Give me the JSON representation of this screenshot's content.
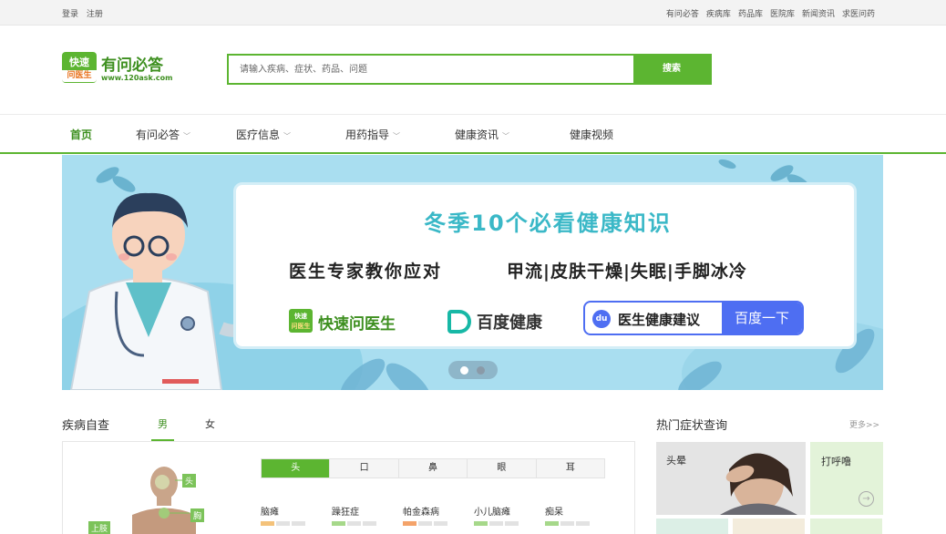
{
  "topbar": {
    "login": "登录",
    "register": "注册",
    "links": [
      "有问必答",
      "疾病库",
      "药品库",
      "医院库",
      "新闻资讯",
      "求医问药"
    ]
  },
  "logo": {
    "badge_top": "快速",
    "badge_bottom": "问医生",
    "name": "有问必答",
    "url": "www.120ask.com"
  },
  "search": {
    "placeholder": "请输入疾病、症状、药品、问题",
    "button": "搜索"
  },
  "nav": {
    "items": [
      "首页",
      "有问必答",
      "医疗信息",
      "用药指导",
      "健康资讯",
      "健康视频"
    ]
  },
  "banner": {
    "headline": "冬季10个必看健康知识",
    "sub1": "医生专家教你应对",
    "sub2": "甲流|皮肤干燥|失眠|手脚冰冷",
    "kuaisu_badge_top": "快速",
    "kuaisu_badge_bottom": "问医生",
    "kuaisu_name": "快速问医生",
    "baidu_name": "百度健康",
    "baidu_paw": "du",
    "baidu_query": "医生健康建议",
    "baidu_button": "百度一下"
  },
  "self_check": {
    "title": "疾病自查",
    "gender_male": "男",
    "gender_female": "女",
    "body_tags": [
      "头",
      "胸",
      "上肢"
    ],
    "part_tabs": [
      "头",
      "口",
      "鼻",
      "眼",
      "耳"
    ],
    "diseases": [
      {
        "name": "脑瘫",
        "level": 1
      },
      {
        "name": "躁狂症",
        "level": 1
      },
      {
        "name": "帕金森病",
        "level": 1
      },
      {
        "name": "小儿脑瘫",
        "level": 1
      },
      {
        "name": "痴呆",
        "level": 1
      }
    ]
  },
  "hot_symptoms": {
    "title": "热门症状查询",
    "more": "更多>>",
    "tiles": [
      "头晕",
      "打呼噜"
    ]
  },
  "colors": {
    "brand_green": "#5cb531",
    "banner_bg": "#a9def0",
    "headline_teal": "#3ab8c7",
    "baidu_blue": "#4e6ef2"
  }
}
